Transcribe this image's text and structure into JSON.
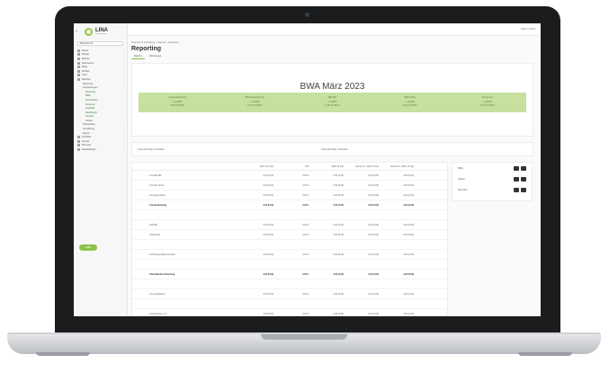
{
  "app": {
    "logo": "LINA",
    "logo_sub": "Steuerberater",
    "user": "Butzer GmbH"
  },
  "sidebar": {
    "company": "Mandant AG",
    "items": [
      {
        "label": "Kasse",
        "level": 0
      },
      {
        "label": "Belege",
        "level": 0
      },
      {
        "label": "Buchen",
        "level": 0
      },
      {
        "label": "Dokumente",
        "level": 0
      },
      {
        "label": "Bank",
        "level": 0
      },
      {
        "label": "DATEV",
        "level": 0
      },
      {
        "label": "Chef",
        "level": 0
      },
      {
        "label": "Berichte",
        "level": 0
      },
      {
        "label": "Reporting",
        "level": 1
      },
      {
        "label": "Auswertungen",
        "level": 1
      },
      {
        "label": "Reporting",
        "level": 2
      },
      {
        "label": "BWA",
        "level": 2
      },
      {
        "label": "Kennzahlen",
        "level": 2
      },
      {
        "label": "Personal",
        "level": 2
      },
      {
        "label": "Liquidität",
        "level": 2
      },
      {
        "label": "Dashboard",
        "level": 2
      },
      {
        "label": "Umsatz",
        "level": 2
      },
      {
        "label": "Kosten",
        "level": 2
      },
      {
        "label": "Übersichten",
        "level": 1
      },
      {
        "label": "Verwaltung",
        "level": 1
      },
      {
        "label": "Export",
        "level": 1
      },
      {
        "label": "Kontakte",
        "level": 0
      },
      {
        "label": "Konten",
        "level": 0
      },
      {
        "label": "Benutzer",
        "level": 0
      },
      {
        "label": "Einstellungen",
        "level": 0
      }
    ],
    "help": "Hilfe"
  },
  "page": {
    "breadcrumb": "Finanzen & Controlling > Reports > Reporting",
    "title": "Reporting",
    "tabs": [
      "Reports",
      "Werkzeuge"
    ]
  },
  "bwa": {
    "title": "BWA März 2023",
    "kpis": [
      {
        "label": "Gesamtleistung",
        "delta": "+ 0,00%",
        "value": "0,00 (0,00%)"
      },
      {
        "label": "Betriebsergebnis",
        "delta": "+ 0,00%",
        "value": "0,00 (0,00%)"
      },
      {
        "label": "WE Bar",
        "delta": "+ 0,00%",
        "value": "0,00 (0,00%)"
      },
      {
        "label": "WE Küche",
        "delta": "+ 0,00%",
        "value": "0,00 (0,00%)"
      },
      {
        "label": "Personal",
        "delta": "+ 0,00%",
        "value": "0,00 (0,00%)"
      }
    ]
  },
  "filters": {
    "left": "Keine Einträge vorhanden",
    "right": "Keine Einträge vorhanden"
  },
  "table": {
    "headers": [
      "",
      "März 23 (4 W)",
      "Soll",
      "März 23 (Ist)",
      "Januar 23 - März 23 (Ist)",
      "Januar 22 - März 22 (Ist)"
    ],
    "rows": [
      {
        "label": "+ Umsatz Bar",
        "values": [
          "0,00 (0,00)",
          "0,00 €",
          "0,00 (0,00)",
          "0,00 (0,00)",
          "0,00 (0,00)"
        ],
        "sum": false
      },
      {
        "label": "+ Umsatz Küche",
        "values": [
          "0,00 (0,00)",
          "0,00 €",
          "0,00 (0,00)",
          "0,00 (0,00)",
          "0,00 (0,00)"
        ],
        "sum": false
      },
      {
        "label": "+ Sonstige Erlöse",
        "values": [
          "0,00 (0,00)",
          "0,00 €",
          "0,00 (0,00)",
          "0,00 (0,00)",
          "0,00 (0,00)"
        ],
        "sum": false
      },
      {
        "label": "= Gesamtleistung",
        "values": [
          "0,00 (0,00)",
          "0,00 €",
          "0,00 (0,00)",
          "0,00 (0,00)",
          "0,00 (0,00)"
        ],
        "sum": true
      },
      {
        "label": "",
        "values": [
          "",
          "",
          "",
          "",
          ""
        ],
        "sum": false
      },
      {
        "label": "+ WE Bar",
        "values": [
          "0,00 (0,00)",
          "0,00 €",
          "0,00 (0,00)",
          "0,00 (0,00)",
          "0,00 (0,00)"
        ],
        "sum": false
      },
      {
        "label": "+ WE Küche",
        "values": [
          "0,00 (0,00)",
          "0,00 €",
          "0,00 (0,00)",
          "0,00 (0,00)",
          "0,00 (0,00)"
        ],
        "sum": false
      },
      {
        "label": "",
        "values": [
          "",
          "",
          "",
          "",
          ""
        ],
        "sum": false
      },
      {
        "label": "+ Rohertrag (Wareneinsatz)",
        "values": [
          "0,00 (0,00)",
          "0,00 €",
          "0,00 (0,00)",
          "0,00 (0,00)",
          "0,00 (0,00)"
        ],
        "sum": false
      },
      {
        "label": "",
        "values": [
          "",
          "",
          "",
          "",
          ""
        ],
        "sum": false
      },
      {
        "label": "= Betriebliches Rohertrag",
        "values": [
          "0,00 (0,00)",
          "0,00 €",
          "0,00 (0,00)",
          "0,00 (0,00)",
          "0,00 (0,00)"
        ],
        "sum": true
      },
      {
        "label": "",
        "values": [
          "",
          "",
          "",
          "",
          ""
        ],
        "sum": false
      },
      {
        "label": "+ Personalkosten",
        "values": [
          "0,00 (0,00)",
          "0,00 €",
          "0,00 (0,00)",
          "0,00 (0,00)",
          "0,00 (0,00)"
        ],
        "sum": false
      },
      {
        "label": "",
        "values": [
          "",
          "",
          "",
          "",
          ""
        ],
        "sum": false
      },
      {
        "label": "+ Raumkosten u. ä.",
        "values": [
          "0,00 (0,00)",
          "0,00 €",
          "0,00 (0,00)",
          "0,00 (0,00)",
          "0,00 (0,00)"
        ],
        "sum": false
      },
      {
        "label": "+ Versicherungen",
        "values": [
          "0,00 (0,00)",
          "0,00 €",
          "0,00 (0,00)",
          "0,00 (0,00)",
          "0,00 (0,00)"
        ],
        "sum": false
      },
      {
        "label": "+ Kfz-Kosten",
        "values": [
          "0,00 (0,00)",
          "0,00 €",
          "0,00 (0,00)",
          "0,00 (0,00)",
          "0,00 (0,00)"
        ],
        "sum": false
      },
      {
        "label": "+ Abschreibungen",
        "values": [
          "0,00 (0,00)",
          "0,00 €",
          "0,00 (0,00)",
          "0,00 (0,00)",
          "0,00 (0,00)"
        ],
        "sum": false
      }
    ]
  },
  "side_panel": {
    "rows": [
      "BWA",
      "Jahres",
      "Summen"
    ]
  }
}
